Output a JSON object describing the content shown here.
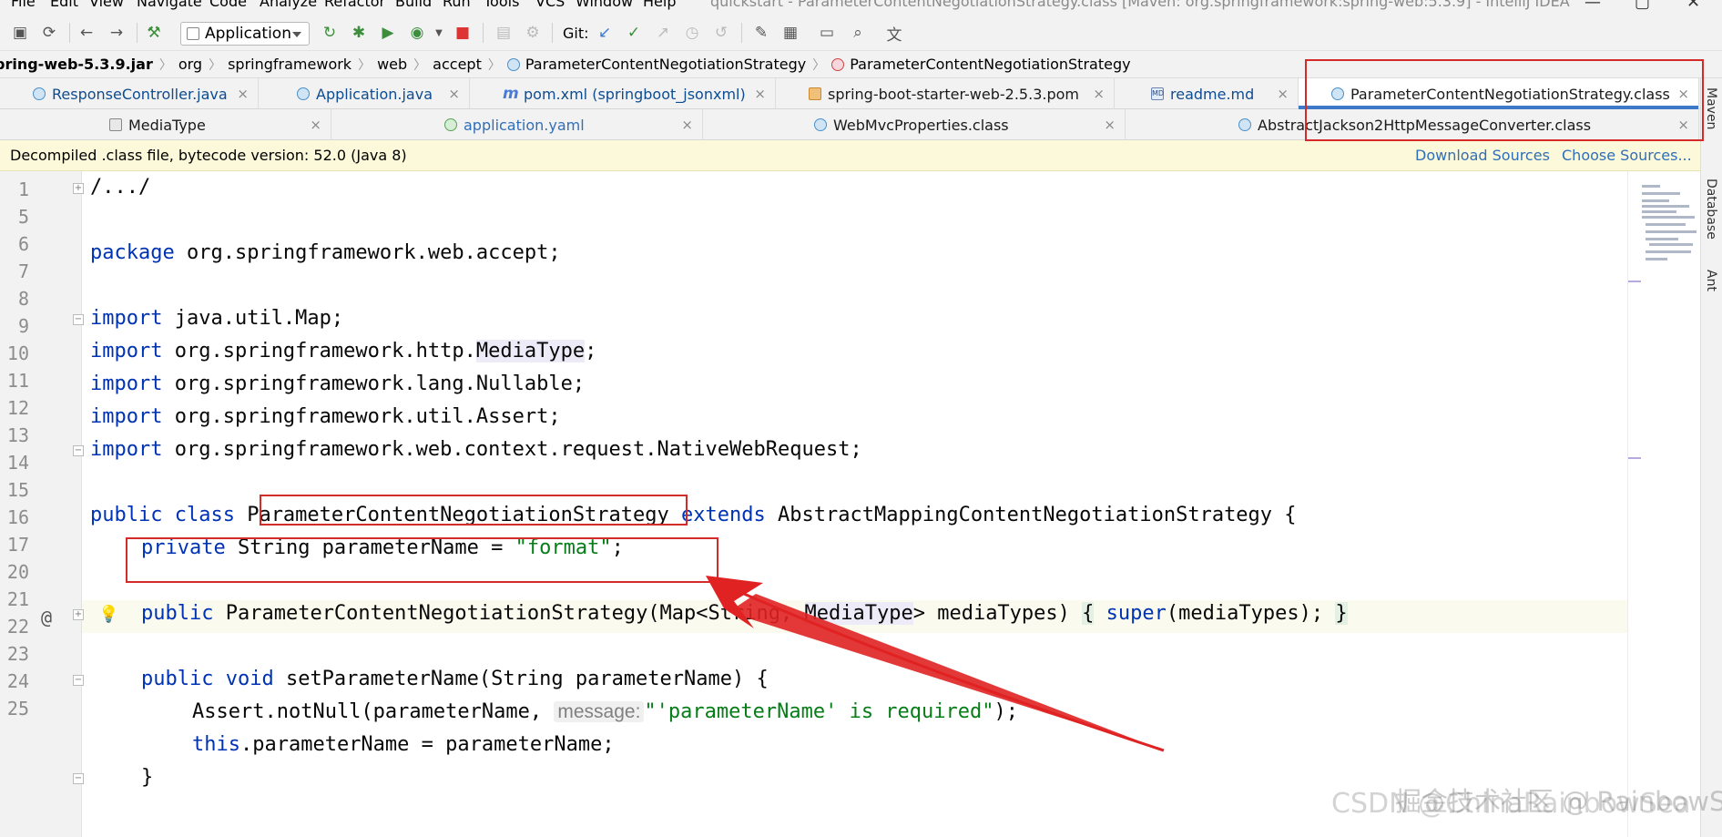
{
  "menu": {
    "items": [
      "File",
      "Edit",
      "View",
      "Navigate",
      "Code",
      "Analyze",
      "Refactor",
      "Build",
      "Run",
      "Tools",
      "VCS",
      "Window",
      "Help"
    ],
    "window_title": "quickstart - ParameterContentNegotiationStrategy.class [Maven: org.springframework:spring-web:5.3.9] - IntelliJ IDEA"
  },
  "toolbar": {
    "run_config": "Application",
    "git_label": "Git:"
  },
  "breadcrumb": {
    "items": [
      "pring-web-5.3.9.jar",
      "org",
      "springframework",
      "web",
      "accept",
      "ParameterContentNegotiationStrategy",
      "ParameterContentNegotiationStrategy"
    ]
  },
  "tabs_row1": [
    {
      "label": "ResponseController.java",
      "icon": "class-icon"
    },
    {
      "label": "Application.java",
      "icon": "class-icon"
    },
    {
      "label": "pom.xml (springboot_jsonxml)",
      "icon": "maven-icon"
    },
    {
      "label": "spring-boot-starter-web-2.5.3.pom",
      "icon": "pom-icon"
    },
    {
      "label": "readme.md",
      "icon": "markdown-icon"
    },
    {
      "label": "ParameterContentNegotiationStrategy.class",
      "icon": "class-icon",
      "active": true
    }
  ],
  "tabs_row2": [
    {
      "label": "MediaType",
      "icon": "type-icon"
    },
    {
      "label": "application.yaml",
      "icon": "yaml-icon"
    },
    {
      "label": "WebMvcProperties.class",
      "icon": "class-icon"
    },
    {
      "label": "AbstractJackson2HttpMessageConverter.class",
      "icon": "class-icon"
    }
  ],
  "infobar": {
    "message": "Decompiled .class file, bytecode version: 52.0 (Java 8)",
    "download_sources": "Download Sources",
    "choose_sources": "Choose Sources..."
  },
  "editor": {
    "line_numbers": [
      "1",
      "5",
      "6",
      "7",
      "8",
      "9",
      "10",
      "11",
      "12",
      "13",
      "14",
      "15",
      "16",
      "17",
      "20",
      "21",
      "22",
      "23",
      "24",
      "25"
    ],
    "lines": {
      "l1": "/.../",
      "l6_kw": "package",
      "l6_rest": " org.springframework.web.accept;",
      "l8_kw": "import",
      "l8_rest": " java.util.Map;",
      "l9_kw": "import",
      "l9_a": " org.springframework.http.",
      "l9_type": "MediaType",
      "l9_b": ";",
      "l10_kw": "import",
      "l10_rest": " org.springframework.lang.Nullable;",
      "l11_kw": "import",
      "l11_rest": " org.springframework.util.Assert;",
      "l12_kw": "import",
      "l12_rest": " org.springframework.web.context.request.NativeWebRequest;",
      "l14_kw1": "public class",
      "l14_name": " ParameterContentNegotiationStrategy ",
      "l14_kw2": "extends",
      "l14_rest": " AbstractMappingContentNegotiationStrategy {",
      "l15_kw": "private",
      "l15_a": " String parameterName = ",
      "l15_str": "\"format\"",
      "l15_b": ";",
      "l17_kw": "public",
      "l17_a": " ParameterContentNegotiationStrategy(Map<String, ",
      "l17_type": "MediaType",
      "l17_b": "> mediaTypes) ",
      "l17_brace1": "{",
      "l17_sp": " ",
      "l17_kw2": "super",
      "l17_c": "(mediaTypes); ",
      "l17_brace2": "}",
      "l21_kw": "public void",
      "l21_rest": " setParameterName(String parameterName) {",
      "l22_a": "Assert.notNull(parameterName, ",
      "l22_hint": "message:",
      "l22_str": "\"'parameterName' is required\"",
      "l22_b": ");",
      "l23_kw": "this",
      "l23_rest": ".parameterName = parameterName;",
      "l24": "}"
    }
  },
  "right_tools": [
    "Maven",
    "Database",
    "Ant"
  ],
  "watermark": "CSDN @ChinaRainbowSea",
  "watermark_overlay": "掘金技术社区 @ RainbowSea",
  "colors": {
    "keyword": "#0033b3",
    "string": "#067d17",
    "annotation_red": "#d42a2a",
    "active_tab_underline": "#3d79c7"
  }
}
